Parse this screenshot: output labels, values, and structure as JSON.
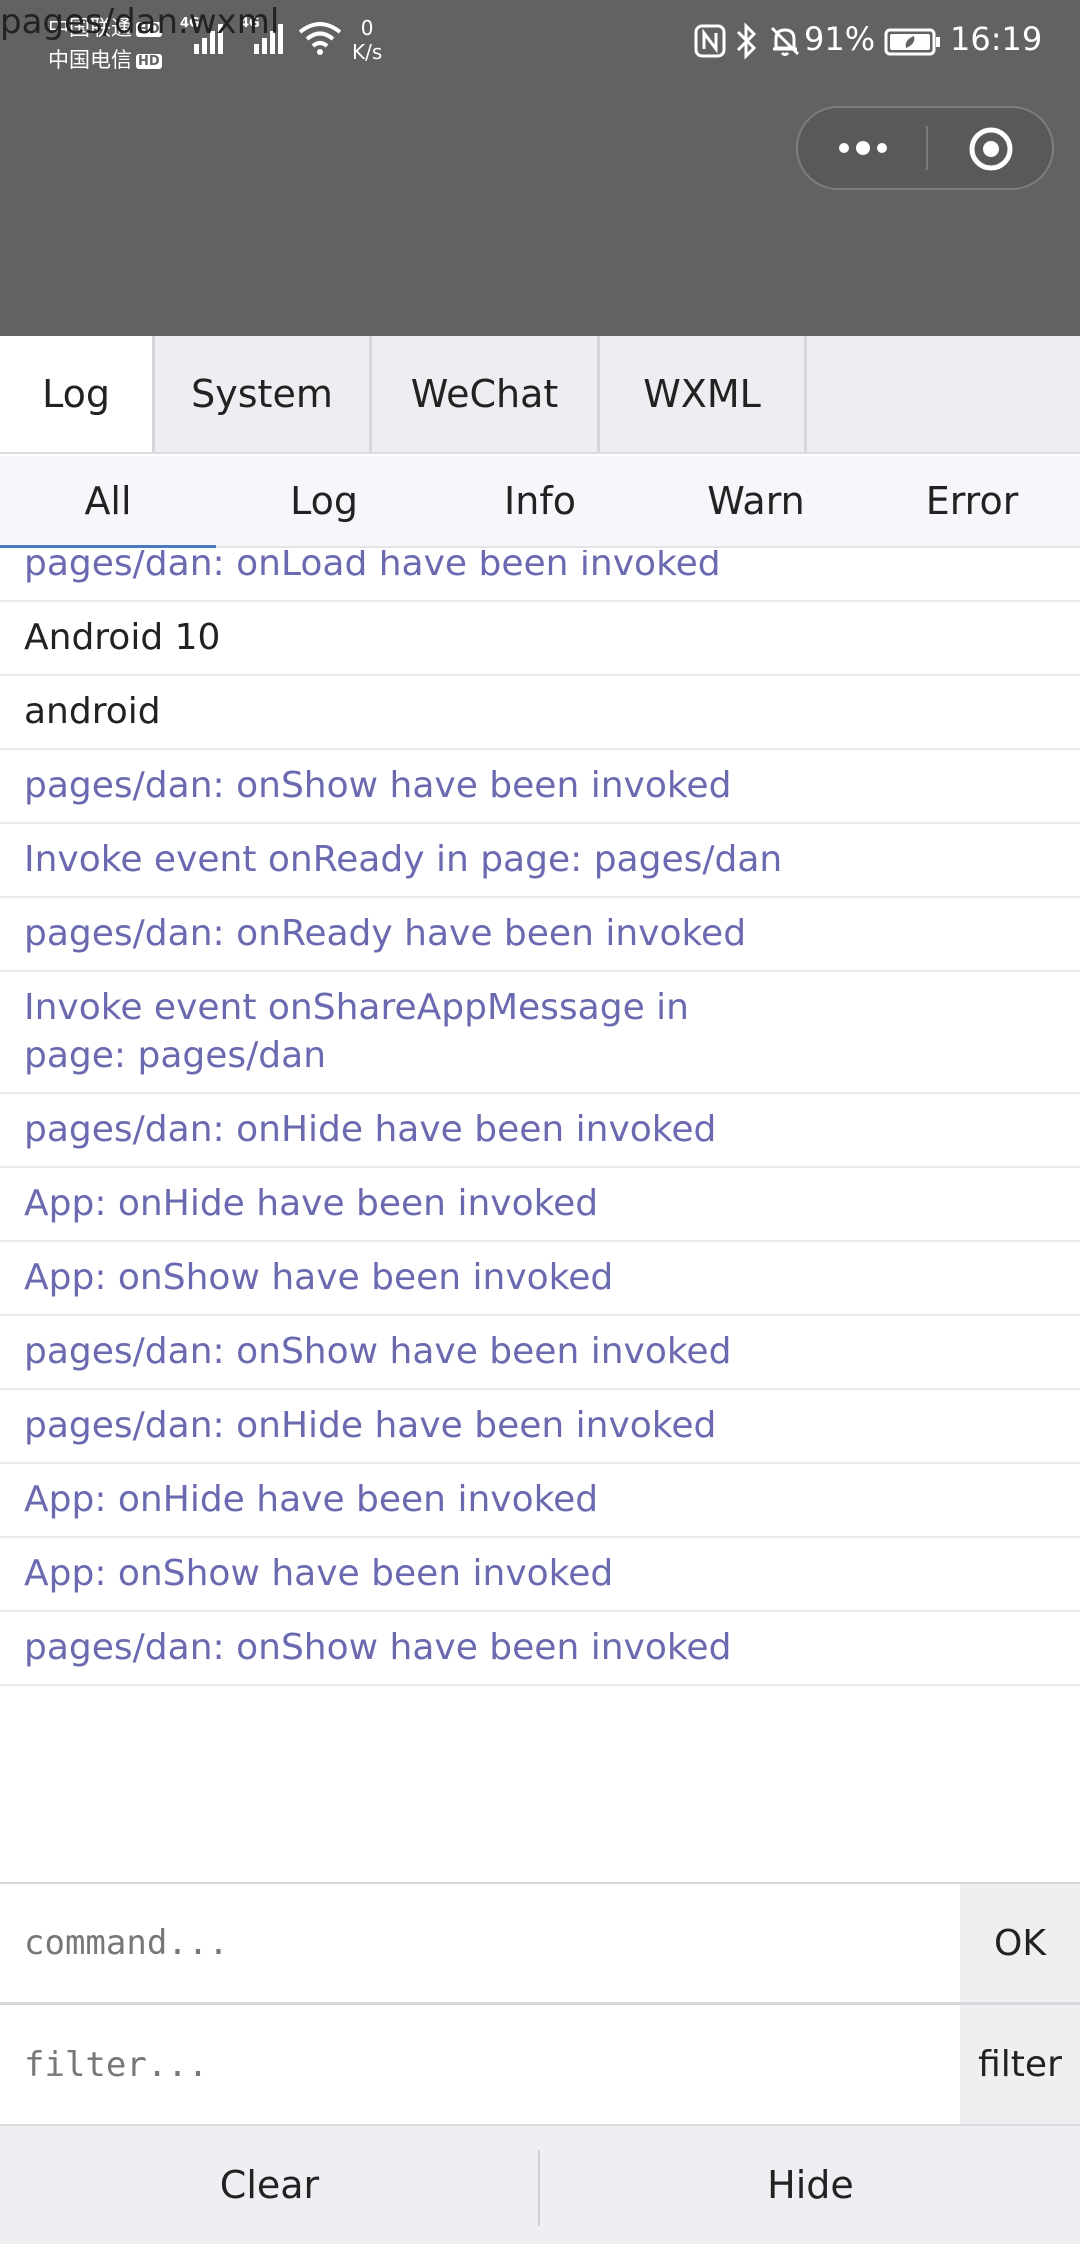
{
  "page_path_text": "pages/dan.wxml",
  "status_bar": {
    "carrier_1": "中国联通",
    "carrier_2": "中国电信",
    "hd_badge": "HD",
    "network_label": "4G",
    "speed_value": "0",
    "speed_unit": "K/s",
    "battery_percent": "91%",
    "time": "16:19",
    "icons": [
      "signal-icon",
      "wifi-icon",
      "nfc-icon",
      "bluetooth-icon",
      "mute-icon",
      "battery-icon"
    ]
  },
  "capsule": {
    "icons": [
      "more-icon",
      "close-miniprogram-icon"
    ]
  },
  "main_tabs": [
    {
      "label": "Log",
      "active": true
    },
    {
      "label": "System",
      "active": false
    },
    {
      "label": "WeChat",
      "active": false
    },
    {
      "label": "WXML",
      "active": false
    }
  ],
  "sub_tabs": [
    {
      "label": "All",
      "active": true
    },
    {
      "label": "Log",
      "active": false
    },
    {
      "label": "Info",
      "active": false
    },
    {
      "label": "Warn",
      "active": false
    },
    {
      "label": "Error",
      "active": false
    }
  ],
  "logs": [
    {
      "text": "pages/dan: onLoad have been invoked",
      "level": "info"
    },
    {
      "text": "Android 10",
      "level": "plain"
    },
    {
      "text": "android",
      "level": "plain"
    },
    {
      "text": "pages/dan: onShow have been invoked",
      "level": "info"
    },
    {
      "text": "Invoke event onReady in page: pages/dan",
      "level": "info"
    },
    {
      "text": "pages/dan: onReady have been invoked",
      "level": "info"
    },
    {
      "text": "Invoke event onShareAppMessage in page: pages/dan",
      "level": "info"
    },
    {
      "text": "pages/dan: onHide have been invoked",
      "level": "info"
    },
    {
      "text": "App: onHide have been invoked",
      "level": "info"
    },
    {
      "text": "App: onShow have been invoked",
      "level": "info"
    },
    {
      "text": "pages/dan: onShow have been invoked",
      "level": "info"
    },
    {
      "text": "pages/dan: onHide have been invoked",
      "level": "info"
    },
    {
      "text": "App: onHide have been invoked",
      "level": "info"
    },
    {
      "text": "App: onShow have been invoked",
      "level": "info"
    },
    {
      "text": "pages/dan: onShow have been invoked",
      "level": "info"
    }
  ],
  "command": {
    "placeholder": "command...",
    "button": "OK"
  },
  "filter": {
    "placeholder": "filter...",
    "button": "filter"
  },
  "bottom": {
    "clear": "Clear",
    "hide": "Hide"
  },
  "colors": {
    "header_bg": "#626262",
    "info_text": "#6b6ab0",
    "active_tab_indicator": "#4a7bc2"
  }
}
